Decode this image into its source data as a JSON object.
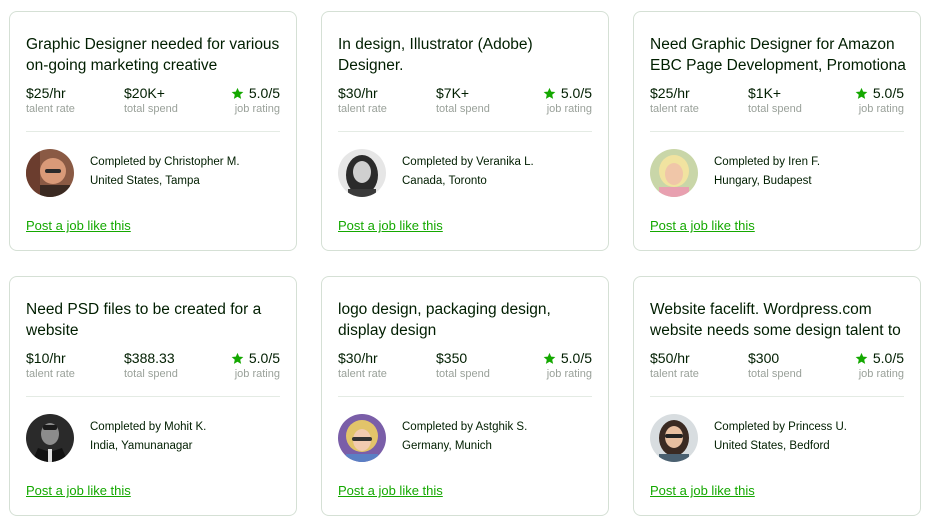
{
  "labels": {
    "talent_rate": "talent rate",
    "total_spend": "total spend",
    "job_rating": "job rating",
    "completed_by_prefix": "Completed by",
    "post_link": "Post a job like this"
  },
  "colors": {
    "accent": "#14a800",
    "border": "#d5e0d5",
    "muted": "#9aa19a"
  },
  "cards": [
    {
      "title": "Graphic Designer needed for various on-going marketing creative",
      "rate": "$25/hr",
      "spend": "$20K+",
      "rating": "5.0/5",
      "completed": "Completed by Christopher M.",
      "location": "United States, Tampa"
    },
    {
      "title": "In design, Illustrator (Adobe) Designer.",
      "rate": "$30/hr",
      "spend": "$7K+",
      "rating": "5.0/5",
      "completed": "Completed by Veranika L.",
      "location": "Canada, Toronto"
    },
    {
      "title": "Need Graphic Designer for Amazon EBC Page Development, Promotiona",
      "rate": "$25/hr",
      "spend": "$1K+",
      "rating": "5.0/5",
      "completed": "Completed by Iren F.",
      "location": "Hungary, Budapest"
    },
    {
      "title": "Need PSD files to be created for a website",
      "rate": "$10/hr",
      "spend": "$388.33",
      "rating": "5.0/5",
      "completed": "Completed by Mohit K.",
      "location": "India, Yamunanagar"
    },
    {
      "title": "logo design, packaging design, display design",
      "rate": "$30/hr",
      "spend": "$350",
      "rating": "5.0/5",
      "completed": "Completed by Astghik S.",
      "location": "Germany, Munich"
    },
    {
      "title": "Website facelift. Wordpress.com website needs some design talent to",
      "rate": "$50/hr",
      "spend": "$300",
      "rating": "5.0/5",
      "completed": "Completed by Princess U.",
      "location": "United States, Bedford"
    }
  ]
}
